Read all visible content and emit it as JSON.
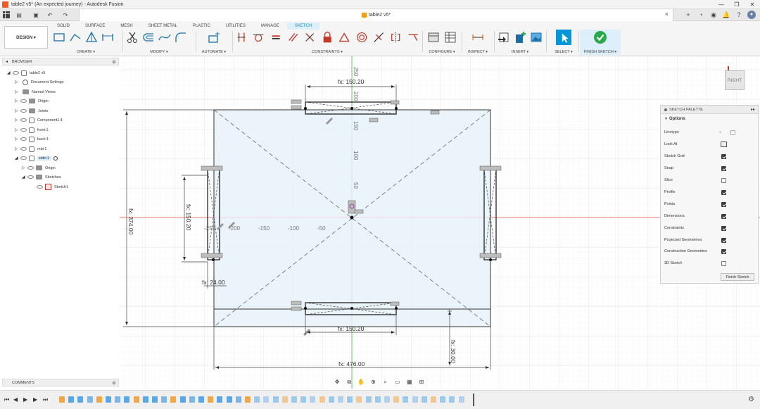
{
  "window": {
    "title": "table2 v5* (An expected journey) - Autodesk Fusion",
    "document_tab": "table2 v5*",
    "controls": [
      "—",
      "❐",
      "✕"
    ]
  },
  "ribbon": {
    "workspace": "DESIGN ▾",
    "tabs": [
      "SOLID",
      "SURFACE",
      "MESH",
      "SHEET METAL",
      "PLASTIC",
      "UTILITIES",
      "MANAGE",
      "SKETCH"
    ],
    "active_tab": "SKETCH",
    "groups": {
      "create": "CREATE ▾",
      "modify": "MODIFY ▾",
      "automate": "AUTOMATE ▾",
      "constraints": "CONSTRAINTS ▾",
      "configure": "CONFIGURE ▾",
      "inspect": "INSPECT ▾",
      "insert": "INSERT ▾",
      "select": "SELECT ▾",
      "finish_sketch": "FINISH SKETCH ▾"
    }
  },
  "browser": {
    "header": "BROWSER",
    "items": [
      {
        "label": "table2 v5",
        "level": 0
      },
      {
        "label": "Document Settings",
        "level": 1
      },
      {
        "label": "Named Views",
        "level": 1
      },
      {
        "label": "Origin",
        "level": 1
      },
      {
        "label": "Joints",
        "level": 1
      },
      {
        "label": "Component1:1",
        "level": 1
      },
      {
        "label": "front:1",
        "level": 1
      },
      {
        "label": "back:1",
        "level": 1
      },
      {
        "label": "mid:1",
        "level": 1
      },
      {
        "label": "side:1",
        "level": 1,
        "active": true
      },
      {
        "label": "Origin",
        "level": 2
      },
      {
        "label": "Sketches",
        "level": 2
      },
      {
        "label": "Sketch1",
        "level": 3
      }
    ]
  },
  "comments": {
    "header": "COMMENTS"
  },
  "viewcube": {
    "face": "RIGHT"
  },
  "sketch_palette": {
    "header": "SKETCH PALETTE",
    "section": "Options",
    "rows": [
      {
        "label": "Linetype",
        "type": "icons"
      },
      {
        "label": "Look At",
        "type": "icon"
      },
      {
        "label": "Sketch Grid",
        "checked": true
      },
      {
        "label": "Snap",
        "checked": true
      },
      {
        "label": "Slice",
        "checked": false
      },
      {
        "label": "Profile",
        "checked": true
      },
      {
        "label": "Points",
        "checked": true
      },
      {
        "label": "Dimensions",
        "checked": true
      },
      {
        "label": "Constraints",
        "checked": true
      },
      {
        "label": "Projected Geometries",
        "checked": true
      },
      {
        "label": "Construction Geometries",
        "checked": true
      },
      {
        "label": "3D Sketch",
        "checked": false
      }
    ],
    "finish_button": "Finish Sketch"
  },
  "sketch": {
    "dimensions": {
      "top_width": "fx: 150.20",
      "bottom_width": "fx: 150.20",
      "left_height": "fx: 150.20",
      "overall_height": "fx: 374.00",
      "overall_width": "fx: 476.00",
      "offset_left": "fx: 24.00",
      "offset_right": "fx: 30.00"
    },
    "axis_labels_x": [
      "-250",
      "-200",
      "-150",
      "-100",
      "-50"
    ],
    "axis_labels_y": [
      "250",
      "200",
      "150",
      "100",
      "50"
    ]
  },
  "colors": {
    "accent": "#0696d7",
    "sketch_fill": "#e6f1fa",
    "origin_x": "#e05353",
    "origin_y": "#3fbf3f",
    "finish_green": "#2ba84a"
  }
}
